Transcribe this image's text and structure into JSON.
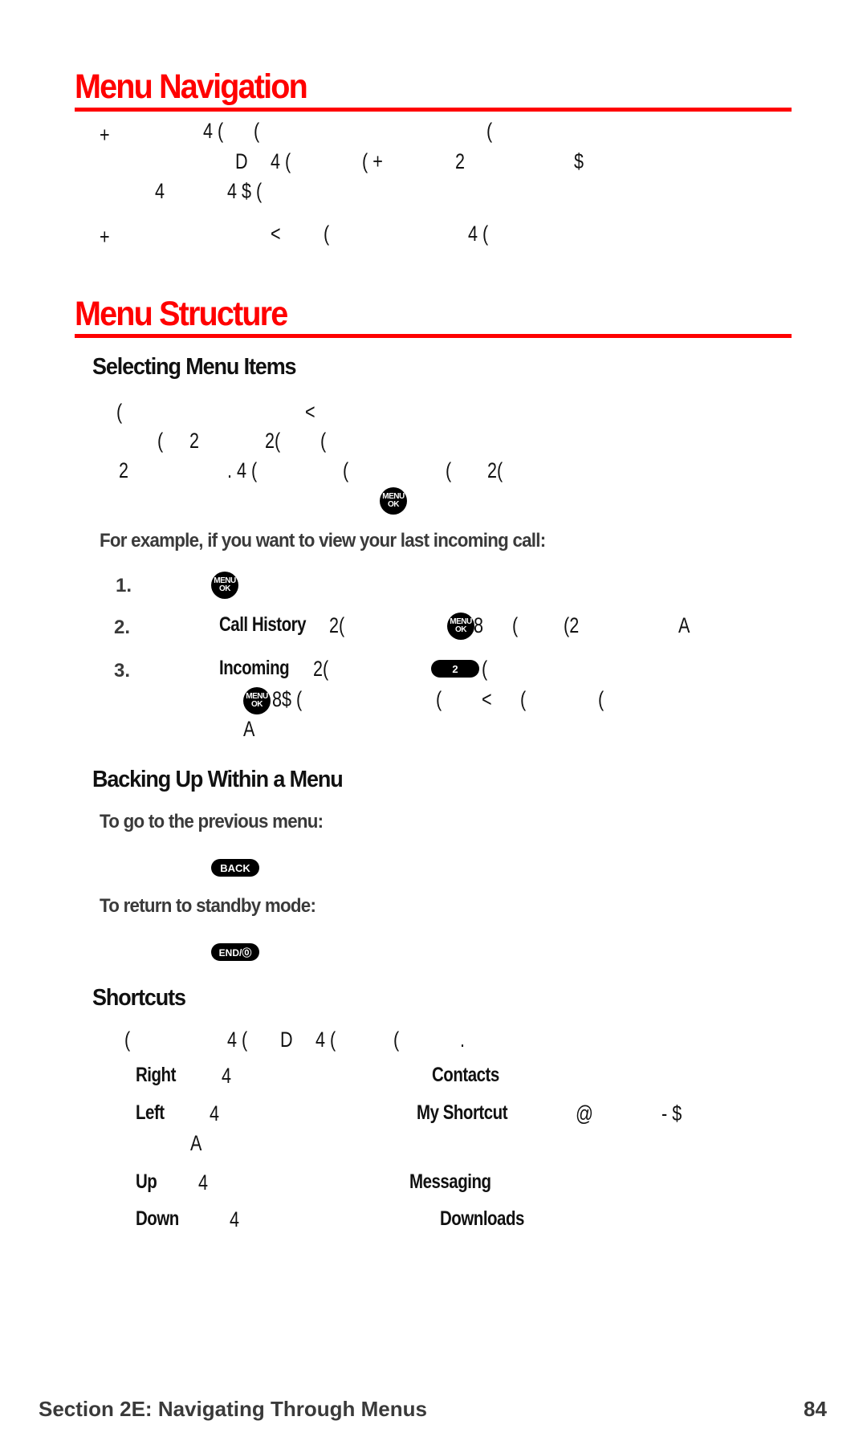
{
  "menu_navigation": {
    "title": "Menu Navigation",
    "para1_line1": [
      "+",
      "4 (",
      "(",
      "("
    ],
    "para1_line2": [
      "D",
      "4 (",
      "( +",
      "2",
      "$"
    ],
    "para1_line3": [
      "4",
      "4 $ ("
    ],
    "para2_line1": [
      "+",
      "<",
      "(",
      "4 ("
    ]
  },
  "menu_structure": {
    "title": "Menu Structure",
    "selecting": {
      "heading": "Selecting Menu Items",
      "line1": [
        "(",
        "<"
      ],
      "line2": [
        "(",
        "2",
        "2(",
        "("
      ],
      "line3": [
        "2",
        ". 4 (",
        "(",
        "(",
        "2("
      ],
      "example_lead": "For example, if you want to view your last incoming call:",
      "steps": [
        {
          "number": "1.",
          "parts": []
        },
        {
          "number": "2.",
          "keyword": "Call History",
          "parts": [
            "2(",
            "8",
            "(",
            "(2",
            "A"
          ]
        },
        {
          "number": "3.",
          "keyword": "Incoming",
          "parts": [
            "2(",
            "("
          ],
          "line2": [
            "8$ (",
            "(",
            "<",
            "(",
            "("
          ],
          "line3": [
            "A"
          ]
        }
      ]
    },
    "backing_up": {
      "heading": "Backing Up Within a Menu",
      "prev_menu_label": "To go to the previous menu:",
      "standby_label": "To return to standby mode:"
    },
    "shortcuts": {
      "heading": "Shortcuts",
      "intro": [
        "(",
        "4 (",
        "D",
        "4 (",
        "(",
        "."
      ],
      "items": [
        {
          "direction": "Right",
          "glyph": "4",
          "target": "Contacts",
          "extra": []
        },
        {
          "direction": "Left",
          "glyph": "4",
          "target": "My Shortcut",
          "extra": [
            "@",
            "- $"
          ],
          "wrap": "A"
        },
        {
          "direction": "Up",
          "glyph": "4",
          "target": "Messaging",
          "extra": []
        },
        {
          "direction": "Down",
          "glyph": "4",
          "target": "Downloads",
          "extra": []
        }
      ]
    }
  },
  "keys": {
    "menu_ok_line1": "MENU",
    "menu_ok_line2": "OK",
    "two": "2",
    "back": "BACK",
    "end": "END/⓪"
  },
  "footer": {
    "section": "Section 2E: Navigating Through Menus",
    "page": "84"
  },
  "colors": {
    "accent": "#ff0000",
    "text": "#111111",
    "subtext": "#3a3a3a"
  }
}
